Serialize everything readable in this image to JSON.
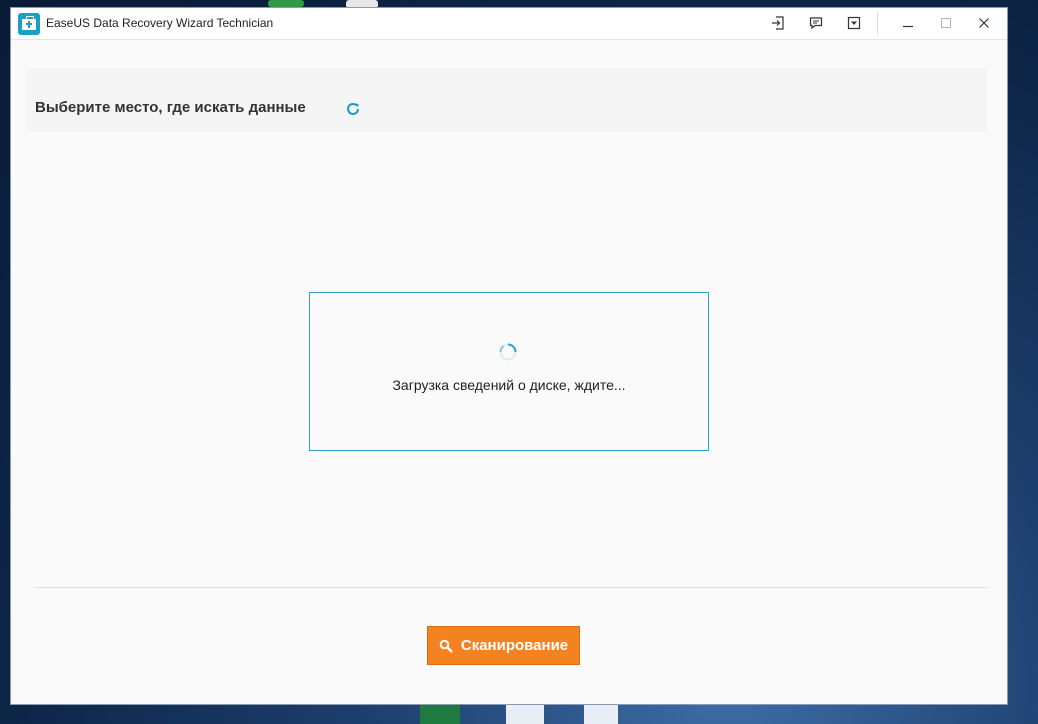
{
  "window": {
    "title": "EaseUS Data Recovery Wizard Technician",
    "controls": [
      "login-icon",
      "feedback-icon",
      "menu-dropdown-icon",
      "minimize-icon",
      "maximize-icon",
      "close-icon"
    ]
  },
  "header": {
    "title": "Выберите место, где искать данные",
    "refresh_icon": "refresh-icon"
  },
  "loading": {
    "text": "Загрузка сведений о диске, ждите...",
    "spinner_icon": "spinner-icon"
  },
  "actions": {
    "scan_label": "Сканирование",
    "scan_icon": "search-icon"
  },
  "colors": {
    "accent": "#1aa0c4",
    "scan_button": "#f58220",
    "loading_border": "#2da2c6"
  }
}
